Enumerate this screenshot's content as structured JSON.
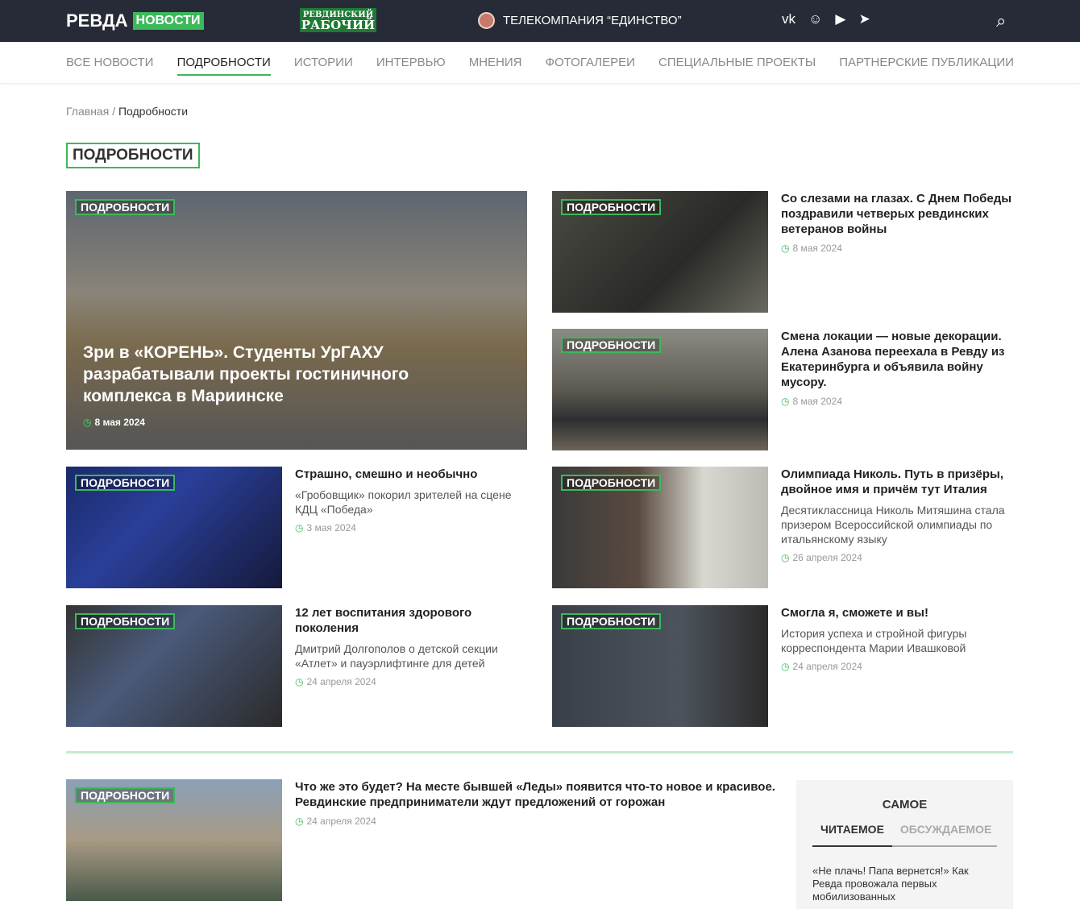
{
  "header": {
    "logo_text": "РЕВДА",
    "logo_badge": "НОВОСТИ",
    "partner_logo_line1": "РЕВДИНСКИЙ",
    "partner_logo_line2": "РАБОЧИЙ",
    "tv_label": "ТЕЛЕКОМПАНИЯ “ЕДИНСТВО”",
    "social": [
      "vk-icon",
      "odnoklassniki-icon",
      "youtube-icon",
      "telegram-icon"
    ]
  },
  "nav": [
    "ВСЕ НОВОСТИ",
    "ПОДРОБНОСТИ",
    "ИСТОРИИ",
    "ИНТЕРВЬЮ",
    "МНЕНИЯ",
    "ФОТОГАЛЕРЕИ",
    "СПЕЦИАЛЬНЫЕ ПРОЕКТЫ",
    "ПАРТНЕРСКИЕ ПУБЛИКАЦИИ"
  ],
  "breadcrumb": {
    "home": "Главная",
    "sep": "/",
    "current": "Подробности"
  },
  "page_title": "ПОДРОБНОСТИ",
  "tag": "ПОДРОБНОСТИ",
  "featured": {
    "title": "Зри в «КОРЕНЬ». Студенты УрГАХУ разрабатывали проекты гостиничного комплекса в Мариинске",
    "date": "8 мая 2024"
  },
  "articles": [
    {
      "title": "Со слезами на глазах. С Днем Победы поздравили четверых ревдинских ветеранов войны",
      "desc": "",
      "date": "8 мая 2024"
    },
    {
      "title": "Смена локации — новые декорации. Алена Азанова переехала в Ревду из Екатеринбурга и объявила войну мусору.",
      "desc": "",
      "date": "8 мая 2024"
    },
    {
      "title": "Страшно, смешно и необычно",
      "desc": "«Гробовщик» покорил зрителей на сцене КДЦ «Победа»",
      "date": "3 мая 2024"
    },
    {
      "title": "Олимпиада Николь. Путь в призёры, двойное имя и причём тут Италия",
      "desc": "Десятиклассница Николь Митяшина стала призером Всероссийской олимпиады по итальянскому языку",
      "date": "26 апреля 2024"
    },
    {
      "title": "12 лет воспитания здорового поколения",
      "desc": "Дмитрий Долгополов о детской секции «Атлет» и пауэрлифтинге для детей",
      "date": "24 апреля 2024"
    },
    {
      "title": "Смогла я, сможете и вы!",
      "desc": "История успеха и стройной фигуры корреспондента Марии Ивашковой",
      "date": "24 апреля 2024"
    },
    {
      "title": "Что же это будет? На месте бывшей «Леды» появится что-то новое и красивое. Ревдинские предприниматели ждут предложений от горожан",
      "desc": "",
      "date": "24 апреля 2024"
    }
  ],
  "sidebar": {
    "title": "САМОЕ",
    "tabs": [
      "ЧИТАЕМОЕ",
      "ОБСУЖДАЕМОЕ"
    ],
    "items": [
      "«Не плачь! Папа вернется!» Как Ревда провожала первых мобилизованных"
    ]
  },
  "colors": {
    "accent": "#3cb95a",
    "header_bg": "#262b37"
  }
}
